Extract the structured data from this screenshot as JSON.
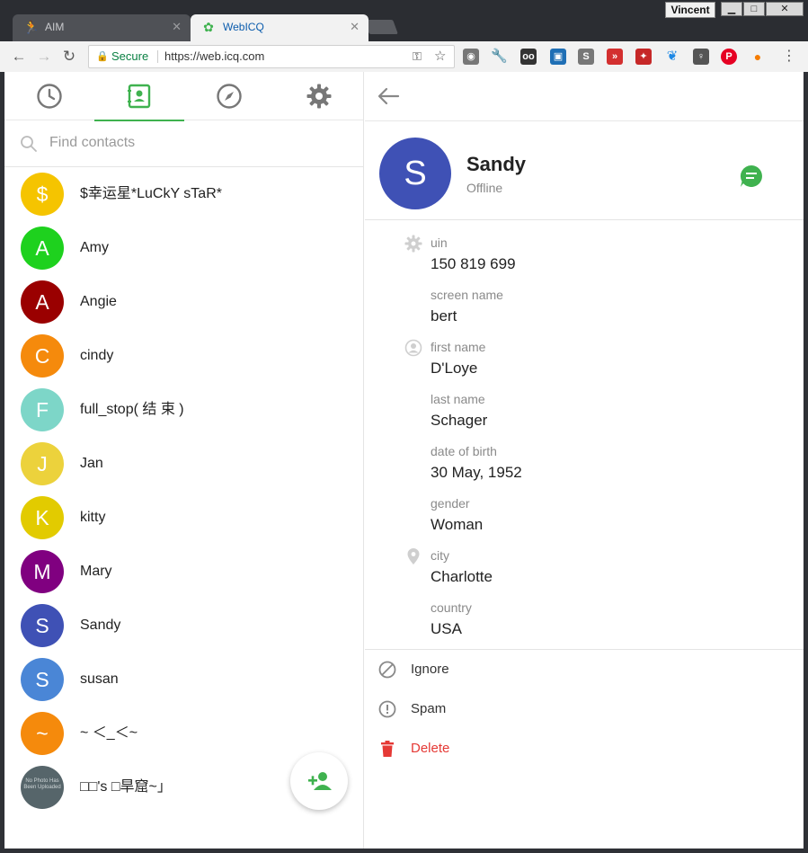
{
  "browser": {
    "user": "Vincent",
    "window_buttons": {
      "minimize": "▁",
      "maximize": "□",
      "close": "✕"
    },
    "tabs": [
      {
        "label": "AIM",
        "icon": "aim-running-man-icon",
        "active": false
      },
      {
        "label": "WebICQ",
        "icon": "icq-flower-icon",
        "active": true
      }
    ],
    "address": {
      "secure_label": "Secure",
      "url": "https://web.icq.com"
    }
  },
  "app": {
    "nav_tabs": [
      "recents-clock-icon",
      "contacts-book-icon",
      "explore-compass-icon",
      "settings-gear-icon"
    ],
    "active_nav": "contacts",
    "search_placeholder": "Find contacts",
    "contacts": [
      {
        "initial": "$",
        "name": "$幸运星*LuCkY sTaR*",
        "color": "#f5c400"
      },
      {
        "initial": "A",
        "name": "Amy",
        "color": "#1ed11e"
      },
      {
        "initial": "A",
        "name": "Angie",
        "color": "#9a0000"
      },
      {
        "initial": "C",
        "name": "cindy",
        "color": "#f58a0c"
      },
      {
        "initial": "F",
        "name": "full_stop( 结 束 )",
        "color": "#7dd6c8"
      },
      {
        "initial": "J",
        "name": "Jan",
        "color": "#ecd23c"
      },
      {
        "initial": "K",
        "name": "kitty",
        "color": "#e2cb00"
      },
      {
        "initial": "M",
        "name": "Mary",
        "color": "#800080"
      },
      {
        "initial": "S",
        "name": "Sandy",
        "color": "#3f51b5"
      },
      {
        "initial": "S",
        "name": "susan",
        "color": "#4a86d6"
      },
      {
        "initial": "~",
        "name": "~ ＜_＜~",
        "color": "#f58a0c"
      },
      {
        "initial": "No Photo Has Been Uploaded",
        "name": "□□'s □旱窟~」",
        "color": "#56656a",
        "photo": true
      }
    ]
  },
  "profile": {
    "initial": "S",
    "name": "Sandy",
    "status": "Offline",
    "fields": [
      {
        "label": "uin",
        "value": "150 819 699",
        "icon": "gear-icon"
      },
      {
        "label": "screen name",
        "value": "bert"
      },
      {
        "label": "first name",
        "value": "D'Loye",
        "icon": "person-icon"
      },
      {
        "label": "last name",
        "value": "Schager"
      },
      {
        "label": "date of birth",
        "value": "30 May, 1952"
      },
      {
        "label": "gender",
        "value": "Woman"
      },
      {
        "label": "city",
        "value": "Charlotte",
        "icon": "location-pin-icon"
      },
      {
        "label": "country",
        "value": "USA"
      }
    ],
    "actions": [
      {
        "label": "Ignore",
        "icon": "block-icon"
      },
      {
        "label": "Spam",
        "icon": "alert-circle-icon"
      },
      {
        "label": "Delete",
        "icon": "trash-icon",
        "danger": true
      }
    ]
  }
}
